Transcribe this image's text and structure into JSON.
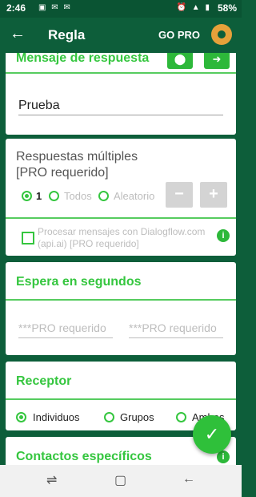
{
  "status": {
    "time": "2:46",
    "battery": "58%"
  },
  "appbar": {
    "title": "Regla",
    "gopro": "GO PRO"
  },
  "section1": {
    "title": "Mensaje de respuesta",
    "input": "Prueba"
  },
  "multi": {
    "title_line1": "Respuestas múltiples",
    "title_line2": "[PRO requerido]",
    "count": "1",
    "opt_all": "Todos",
    "opt_random": "Aleatorio",
    "minus": "−",
    "plus": "+"
  },
  "dialogflow": {
    "line1": "Procesar mensajes con Dialogflow.com",
    "line2": "(api.ai) [PRO requerido]"
  },
  "wait": {
    "title": "Espera en segundos",
    "field1": "***PRO requerido",
    "field2": "***PRO requerido"
  },
  "receptor": {
    "title": "Receptor",
    "opt1": "Individuos",
    "opt2": "Grupos",
    "opt3": "Ambos"
  },
  "contacts": {
    "title": "Contactos específicos"
  }
}
